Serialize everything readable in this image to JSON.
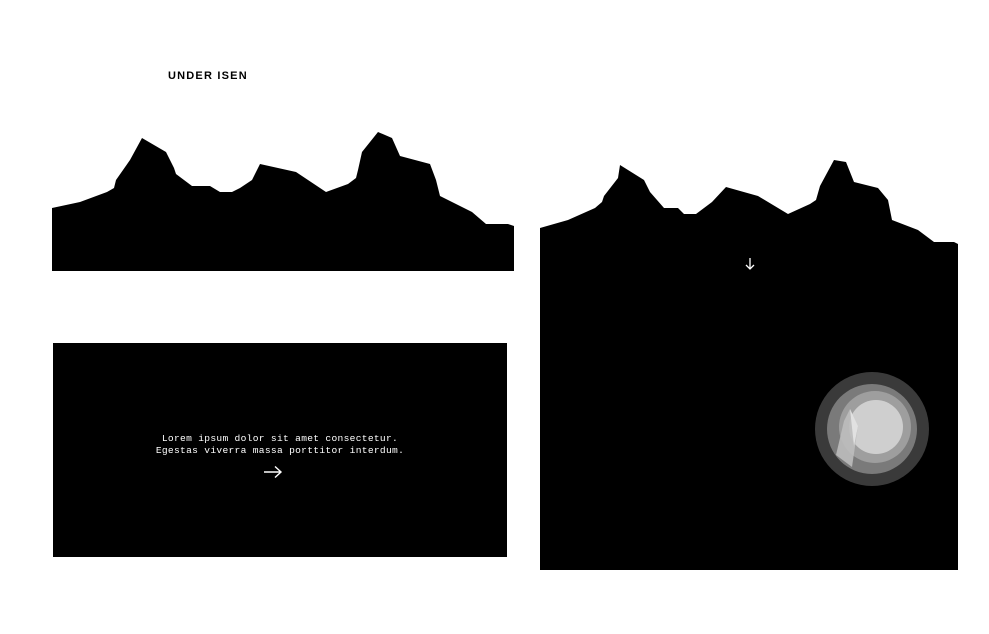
{
  "brand": {
    "title": "UNDER ISEN"
  },
  "hero": {
    "line1": "Lorem ipsum dolor sit amet consectetur.",
    "line2": "Egestas viverra massa porttitor interdum."
  },
  "icons": {
    "next": "arrow-right-icon",
    "scroll": "arrow-down-icon",
    "orb": "layered-circle-icon"
  },
  "colors": {
    "background": "#ffffff",
    "ink": "#000000",
    "text_on_dark": "#ffffff",
    "orb_ring_outer": "#3a3a3a",
    "orb_ring_mid": "#7a7a7a",
    "orb_ring_inner": "#9e9e9e",
    "orb_core": "#cfcfcf"
  }
}
